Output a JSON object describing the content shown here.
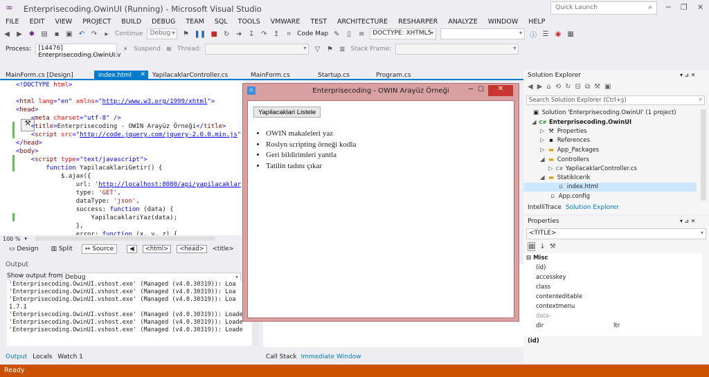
{
  "title": "Enterprisecoding.OwinUI (Running) - Microsoft Visual Studio",
  "quick_launch": "Quick Launch",
  "menu": [
    "FILE",
    "EDIT",
    "VIEW",
    "PROJECT",
    "BUILD",
    "DEBUG",
    "TEAM",
    "SQL",
    "TOOLS",
    "VMWARE",
    "TEST",
    "ARCHITECTURE",
    "RESHARPER",
    "ANALYZE",
    "WINDOW",
    "HELP"
  ],
  "toolbar1": {
    "continue": "Continue",
    "config": "Debug",
    "codemap": "Code Map",
    "doctype": "DOCTYPE: XHTML5"
  },
  "toolbar2": {
    "process_label": "Process:",
    "process": "[14476] Enterprisecoding.OwinUI.v",
    "suspend": "Suspend",
    "thread": "Thread:",
    "stackframe": "Stack Frame:"
  },
  "tabs": [
    "MainForm.cs [Design]",
    "index.html",
    "YapilacaklarController.cs",
    "MainForm.cs",
    "Startup.cs",
    "Program.cs"
  ],
  "editor": {
    "zoom": "100 %",
    "view_buttons": {
      "design": "Design",
      "split": "Split",
      "source": "Source"
    },
    "crumbs": [
      "<html>",
      "<head>",
      "<title>"
    ]
  },
  "output": {
    "title": "Output",
    "from_label": "Show output from:",
    "from_value": "Debug",
    "lines": [
      "'Enterprisecoding.OwinUI.vshost.exe' (Managed (v4.0.30319)): Loa",
      "'Enterprisecoding.OwinUI.vshost.exe' (Managed (v4.0.30319)): Loa",
      "'Enterprisecoding.OwinUI.vshost.exe' (Managed (v4.0.30319)): Loa",
      "1.7.1",
      "'Enterprisecoding.OwinUI.vshost.exe' (Managed (v4.0.30319)): Loade",
      "'Enterprisecoding.OwinUI.vshost.exe' (Managed (v4.0.30319)): Loade",
      "'Enterprisecoding.OwinUI.vshost.exe' (Managed (v4.0.30319)): Loade"
    ],
    "tabs": [
      "Output",
      "Locals",
      "Watch 1"
    ]
  },
  "bottom_right_tabs": [
    "Call Stack",
    "Immediate Window"
  ],
  "solution": {
    "title": "Solution Explorer",
    "search": "Search Solution Explorer (Ctrl+ş)",
    "items": [
      "Solution 'Enterprisecoding.OwinUI' (1 project)",
      "Enterprisecoding.OwinUI",
      "Properties",
      "References",
      "App_Packages",
      "Controllers",
      "YapilacaklarController.cs",
      "StatikIcerik",
      "index.html",
      "App.config"
    ],
    "tabs": [
      "IntelliTrace",
      "Solution Explorer"
    ]
  },
  "properties": {
    "title": "Properties",
    "object": "<TITLE>",
    "category": "Misc",
    "rows": [
      {
        "name": "(id)",
        "value": ""
      },
      {
        "name": "accesskey",
        "value": ""
      },
      {
        "name": "class",
        "value": ""
      },
      {
        "name": "contenteditable",
        "value": ""
      },
      {
        "name": "contextmenu",
        "value": ""
      },
      {
        "name": "data-",
        "value": ""
      },
      {
        "name": "dir",
        "value": "ltr"
      }
    ],
    "footer": "(id)"
  },
  "status": "Ready",
  "app": {
    "title": "Enterprisecoding - OWIN Arayüz Örneği",
    "button": "Yapilacaklari Listele",
    "items": [
      "OWIN makaleleri yaz",
      "Roslyn scripting örneği kodla",
      "Geri bildirimleri yantla",
      "Tatilin tadını çıkar"
    ]
  }
}
